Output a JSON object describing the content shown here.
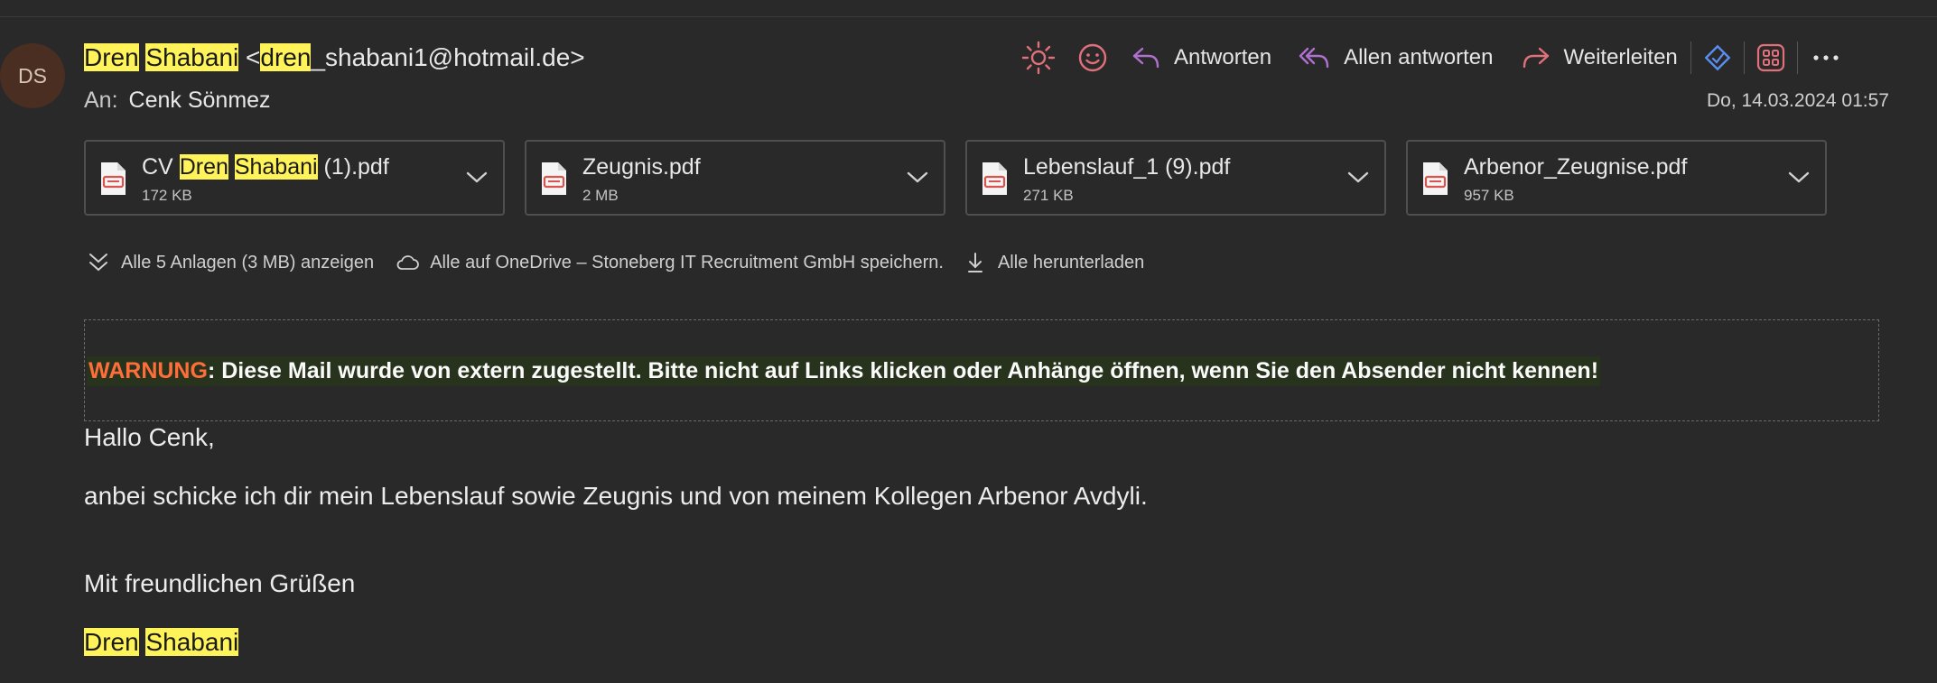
{
  "sender": {
    "initials": "DS",
    "first": "Dren",
    "last": "Shabani",
    "email_open": "<",
    "email_hl": "dren",
    "email_rest": "_shabani1@hotmail.de>"
  },
  "recipient": {
    "label": "An:",
    "name": "Cenk Sönmez"
  },
  "date": "Do, 14.03.2024 01:57",
  "toolbar": {
    "reply": "Antworten",
    "reply_all": "Allen antworten",
    "forward": "Weiterleiten"
  },
  "attachments": [
    {
      "prefix": "CV",
      "hl1": "Dren",
      "hl2": "Shabani",
      "suffix": "(1).pdf",
      "size": "172 KB"
    },
    {
      "name": "Zeugnis.pdf",
      "size": "2 MB"
    },
    {
      "name": "Lebenslauf_1 (9).pdf",
      "size": "271 KB"
    },
    {
      "name": "Arbenor_Zeugnise.pdf",
      "size": "957 KB"
    }
  ],
  "actions": {
    "show_all": "Alle 5 Anlagen (3 MB) anzeigen",
    "onedrive": "Alle auf OneDrive – Stoneberg IT Recruitment GmbH speichern.",
    "download": "Alle herunterladen"
  },
  "warning": {
    "label": "WARNUNG",
    "text": ": Diese Mail wurde von extern zugestellt. Bitte nicht auf Links klicken oder Anhänge öffnen, wenn Sie den Absender nicht kennen!"
  },
  "body": {
    "greeting": "Hallo Cenk,",
    "line1": "anbei schicke ich dir mein Lebenslauf sowie Zeugnis und von meinem Kollegen Arbenor Avdyli.",
    "closing": "Mit freundlichen Grüßen",
    "sig_first": "Dren",
    "sig_last": "Shabani"
  },
  "colors": {
    "background": "#292929",
    "highlight": "#fff35a",
    "warning": "#ff6e3a",
    "accent_pink": "#e0707a",
    "accent_purple": "#b070d0",
    "accent_blue": "#5b8ff0"
  }
}
